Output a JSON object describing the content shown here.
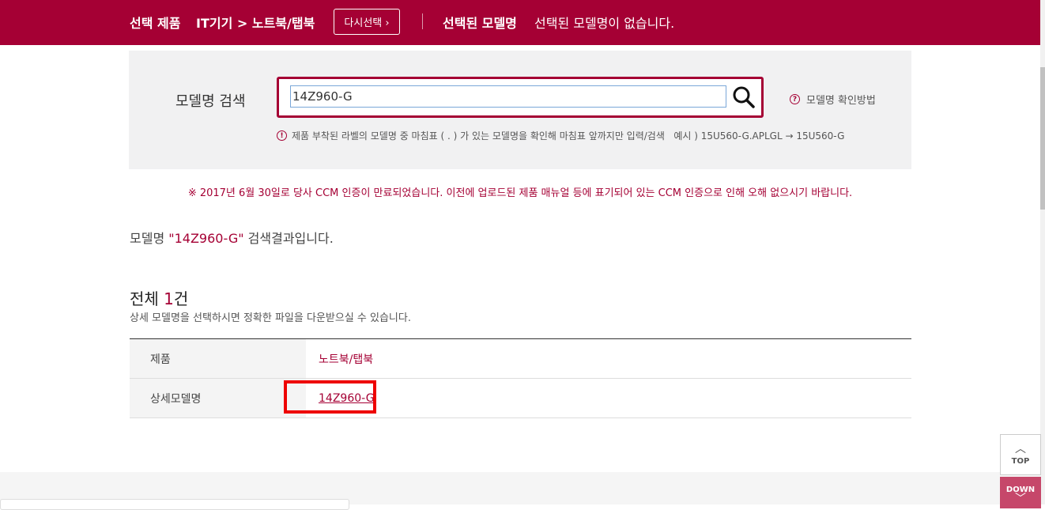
{
  "header": {
    "selected_product_label": "선택 제품",
    "category_path": "IT기기 > 노트북/탭북",
    "reselect_button": "다시선택 ›",
    "selected_model_label": "선택된 모델명",
    "selected_model_value": "선택된 모델명이 없습니다."
  },
  "search": {
    "label": "모델명 검색",
    "input_value": "14Z960-G",
    "search_icon": "search-icon",
    "help_link": "모델명 확인방법",
    "note": "제품 부착된 라벨의 모델명 중 마침표 ( . ) 가 있는 모델명을 확인해 마침표 앞까지만 입력/검색   예시 ) 15U560-G.APLGL → 15U560-G"
  },
  "notice": "※ 2017년 6월 30일로 당사 CCM 인증이 만료되었습니다. 이전에 업로드된 제품 매뉴얼 등에 표기되어 있는 CCM 인증으로 인해 오해 없으시기 바랍니다.",
  "result": {
    "prefix": "모델명 ",
    "query": "\"14Z960-G\"",
    "suffix": " 검색결과입니다.",
    "total_prefix": "전체 ",
    "total_count": "1",
    "total_suffix": "건",
    "subtitle": "상세 모델명을 선택하시면 정확한 파일을 다운받으실 수 있습니다."
  },
  "table": {
    "rows": [
      {
        "header": "제품",
        "value": "노트북/탭북"
      },
      {
        "header": "상세모델명",
        "value": "14Z960-G"
      }
    ]
  },
  "floating": {
    "top_label": "TOP",
    "down_label": "DOWN"
  },
  "colors": {
    "brand": "#a50034",
    "highlight": "#ee0000"
  }
}
